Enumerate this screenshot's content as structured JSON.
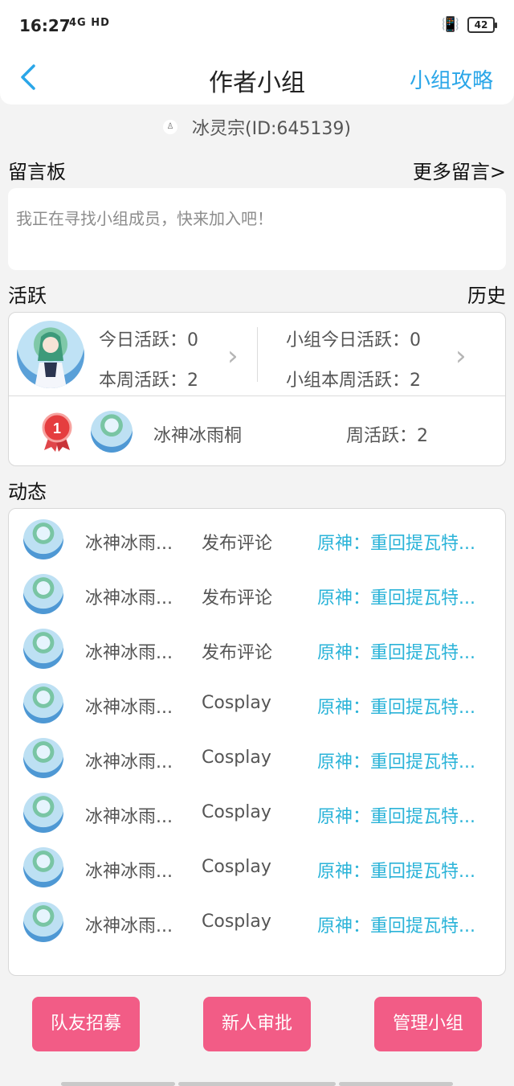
{
  "status_bar": {
    "time": "16:27",
    "network": "4G HD",
    "battery": "42"
  },
  "nav": {
    "title": "作者小组",
    "guide_link": "小组攻略"
  },
  "group": {
    "id_text": "冰灵宗(ID:645139)"
  },
  "message_board": {
    "label": "留言板",
    "more_link": "更多留言>",
    "content": "我正在寻找小组成员，快来加入吧！"
  },
  "activity": {
    "label": "活跃",
    "history_link": "历史",
    "today_active": "今日活跃：0",
    "week_active": "本周活跃：2",
    "group_today_active": "小组今日活跃：0",
    "group_week_active": "小组本周活跃：2",
    "rank": {
      "position": "1",
      "name": "冰神冰雨桐",
      "weekly": "周活跃：2"
    }
  },
  "feed": {
    "label": "动态",
    "items": [
      {
        "user": "冰神冰雨...",
        "action": "发布评论",
        "target": "原神：重回提瓦特..."
      },
      {
        "user": "冰神冰雨...",
        "action": "发布评论",
        "target": "原神：重回提瓦特..."
      },
      {
        "user": "冰神冰雨...",
        "action": "发布评论",
        "target": "原神：重回提瓦特..."
      },
      {
        "user": "冰神冰雨...",
        "action": "Cosplay",
        "target": "原神：重回提瓦特..."
      },
      {
        "user": "冰神冰雨...",
        "action": "Cosplay",
        "target": "原神：重回提瓦特..."
      },
      {
        "user": "冰神冰雨...",
        "action": "Cosplay",
        "target": "原神：重回提瓦特..."
      },
      {
        "user": "冰神冰雨...",
        "action": "Cosplay",
        "target": "原神：重回提瓦特..."
      },
      {
        "user": "冰神冰雨...",
        "action": "Cosplay",
        "target": "原神：重回提瓦特..."
      }
    ]
  },
  "actions": {
    "recruit": "队友招募",
    "approve": "新人审批",
    "manage": "管理小组"
  },
  "colors": {
    "accent_blue": "#2aa6e8",
    "link_cyan": "#2ab3d8",
    "button_pink": "#f25c86"
  }
}
